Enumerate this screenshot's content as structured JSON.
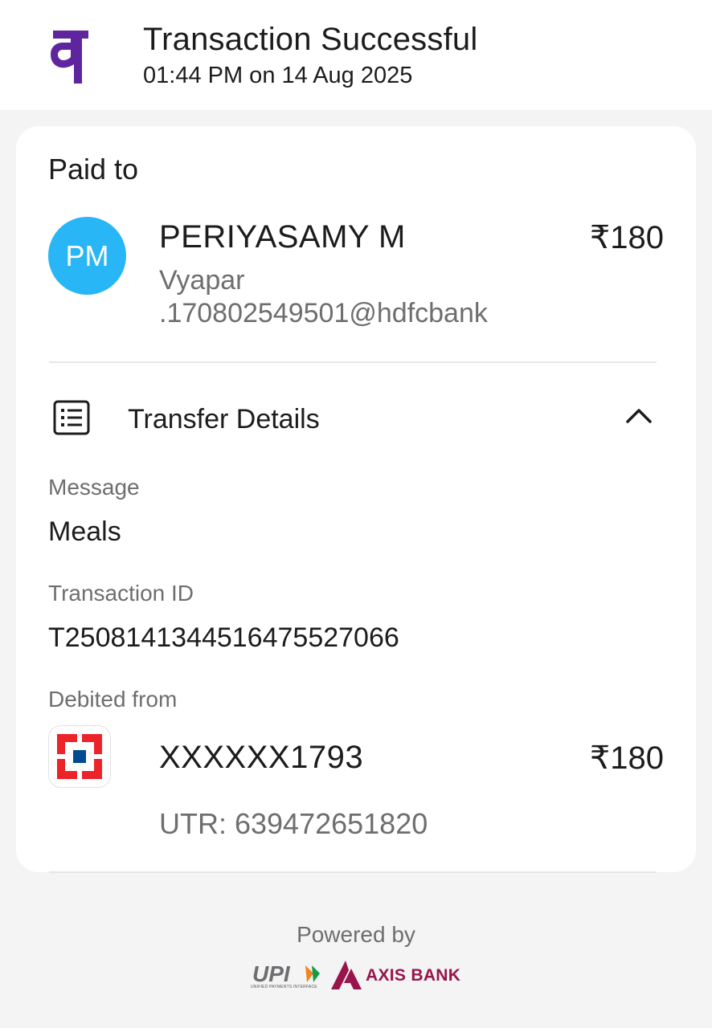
{
  "header": {
    "app_logo_icon": "phonepe-logo-icon",
    "title": "Transaction Successful",
    "timestamp": "01:44 PM on 14 Aug 2025"
  },
  "paid_to": {
    "label": "Paid to",
    "avatar_initials": "PM",
    "avatar_color": "#28b6f6",
    "name": "PERIYASAMY M",
    "amount": "₹180",
    "vpa": "Vyapar .170802549501@hdfcbank"
  },
  "transfer_details": {
    "label": "Transfer Details",
    "expanded": true,
    "icon": "list-icon",
    "fields": {
      "message_label": "Message",
      "message_value": "Meals",
      "txn_id_label": "Transaction ID",
      "txn_id_value": "T2508141344516475527066",
      "debited_label": "Debited from"
    },
    "account": {
      "bank_icon": "hdfc-bank-logo-icon",
      "number": "XXXXXX1793",
      "amount": "₹180",
      "utr": "UTR: 639472651820"
    }
  },
  "footer": {
    "powered_by": "Powered by",
    "upi_text": "UPI",
    "upi_subtext": "UNIFIED PAYMENTS INTERFACE",
    "axis_text": "AXIS BANK",
    "axis_color": "#97144d"
  },
  "colors": {
    "brand_purple": "#5f259f",
    "background": "#f4f4f4"
  }
}
